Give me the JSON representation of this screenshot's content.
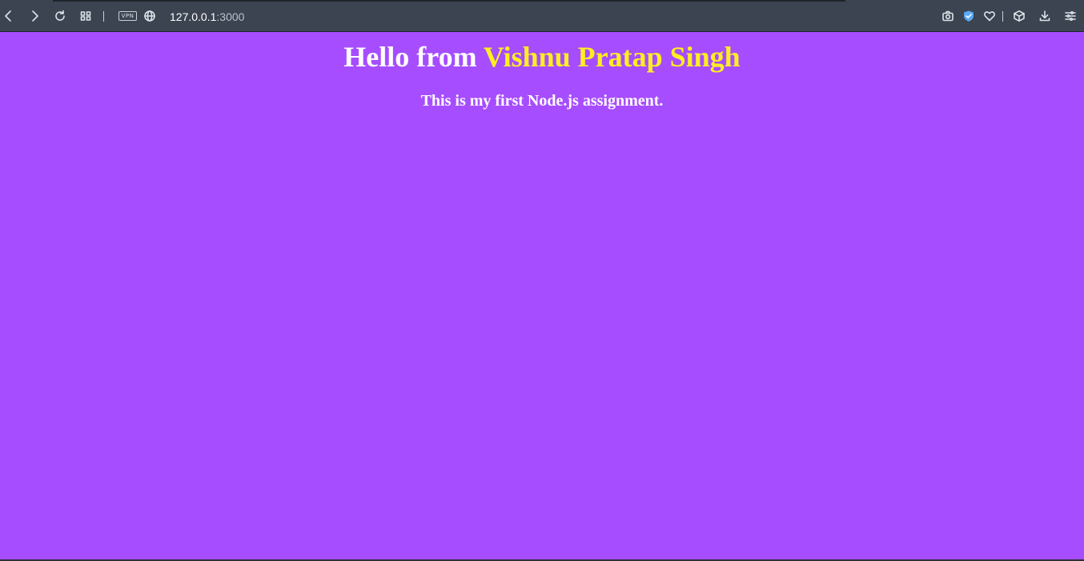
{
  "browser": {
    "address_host": "127.0.0.1",
    "address_port": ":3000",
    "vpn_label": "VPN",
    "icons": [
      "back-icon",
      "forward-icon",
      "reload-icon",
      "tabs-grid-icon",
      "vpn-icon",
      "globe-icon",
      "camera-icon",
      "shield-icon",
      "heart-icon",
      "box-icon",
      "download-icon",
      "menu-icon"
    ]
  },
  "page": {
    "heading_prefix": "Hello from ",
    "heading_name": "Vishnu Pratap Singh",
    "subheading": "This is my first Node.js assignment.",
    "background_color": "#a64dff",
    "name_color": "#ffee22"
  }
}
